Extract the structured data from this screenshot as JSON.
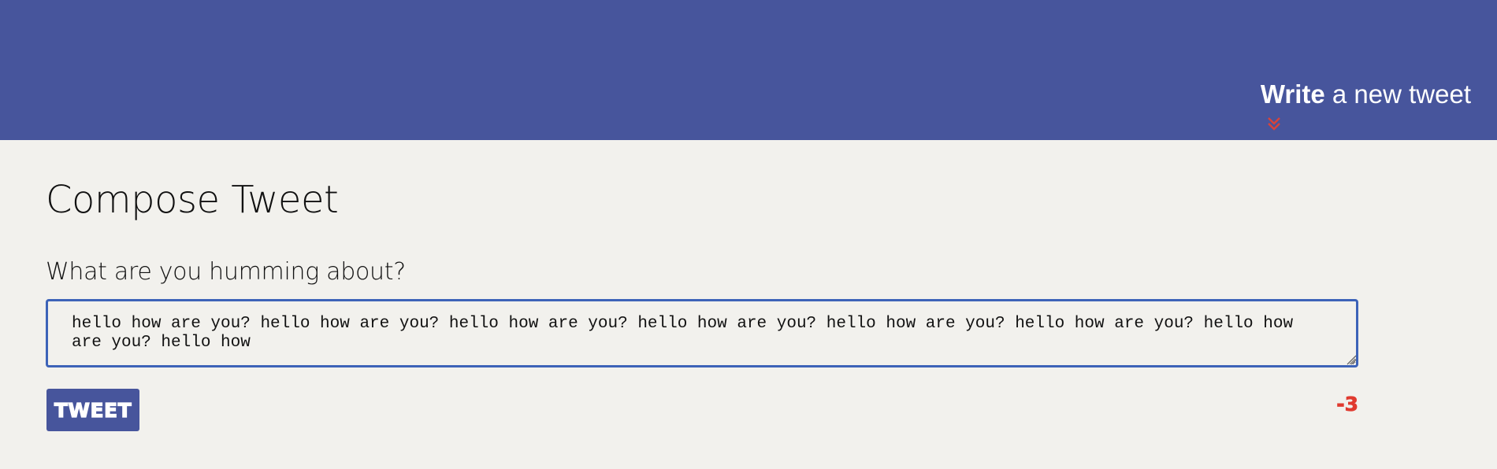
{
  "nav": {
    "toggle_bold": "Write",
    "toggle_rest": " a new tweet",
    "toggle_icon": "double-chevron-down-icon",
    "background_color": "#47559c",
    "icon_color": "#d9433a"
  },
  "compose": {
    "title": "Compose Tweet",
    "label": "What are you humming about?",
    "textarea_value": "hello how are you? hello how are you? hello how are you? hello how are you? hello how are you? hello how are you? hello how are you? hello how",
    "submit_label": "TWEET",
    "counter": "-3",
    "counter_color": "#e03a2f",
    "focus_border_color": "#3d63b8"
  }
}
